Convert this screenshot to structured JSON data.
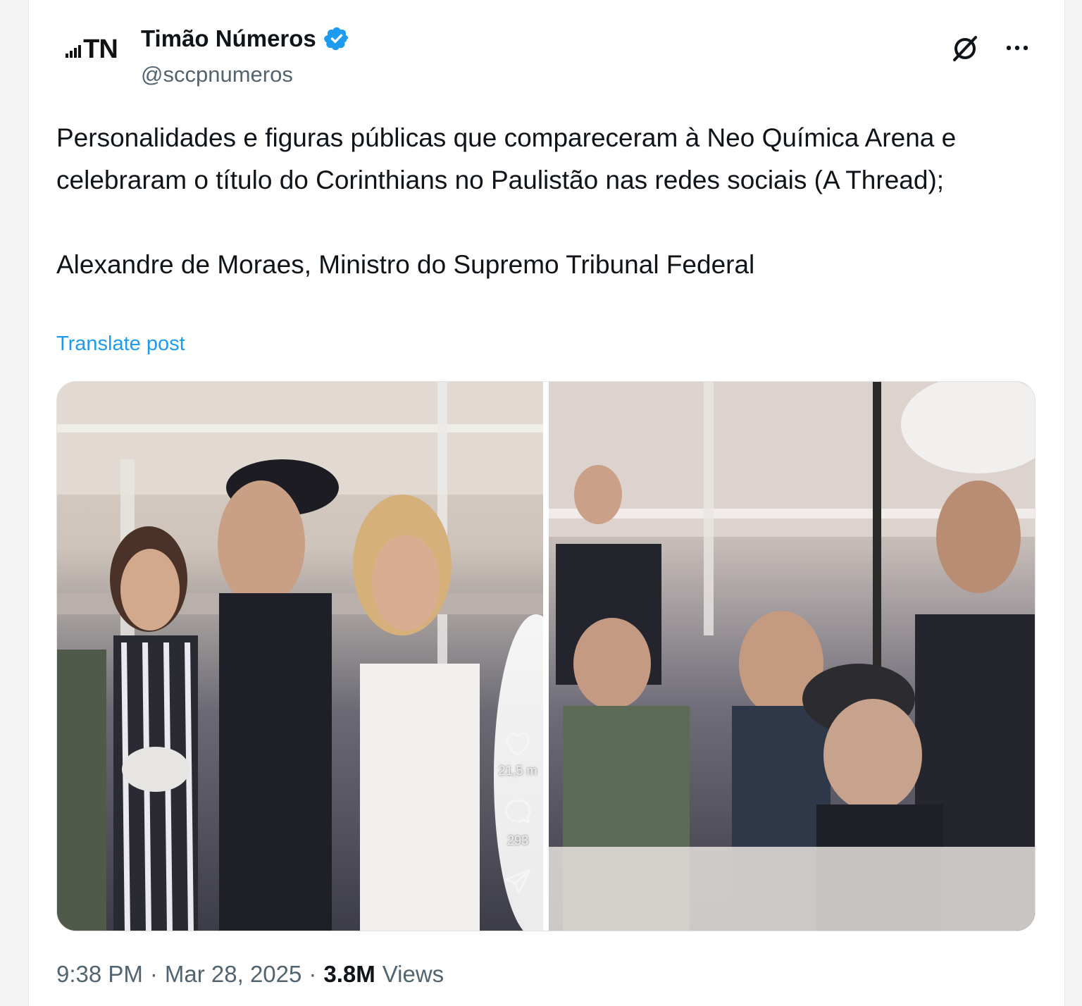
{
  "post": {
    "author": {
      "name": "Timão Números",
      "handle": "@sccpnumeros",
      "avatar_text": "TN",
      "verified": true
    },
    "text": {
      "paragraph1": "Personalidades e figuras públicas que compareceram à Neo Química Arena e celebraram o título do Corinthians no Paulistão nas redes sociais (A Thread);",
      "paragraph2": "Alexandre de Moraes, Ministro do Supremo Tribunal Federal"
    },
    "translate_label": "Translate post",
    "time": "9:38 PM",
    "date": "Mar 28, 2025",
    "separator": "·",
    "views_count": "3.8M",
    "views_label": "Views"
  },
  "media": {
    "left_overlay": {
      "likes": "21,5 m",
      "comments": "293"
    }
  },
  "colors": {
    "accent": "#1d9bf0",
    "text": "#0f1419",
    "muted": "#536471"
  },
  "icons": [
    "verified-badge-icon",
    "grok-icon",
    "more-icon",
    "heart-icon",
    "comment-icon",
    "share-icon"
  ]
}
